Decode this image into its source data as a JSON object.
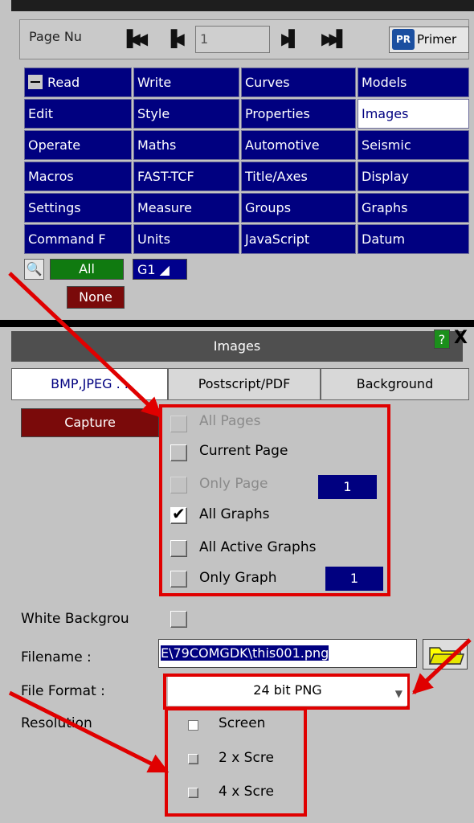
{
  "page_nav": {
    "label": "Page Nu",
    "page_value": "1",
    "primer_label": "Primer",
    "primer_logo": "PR"
  },
  "menu": {
    "rows": [
      [
        {
          "label": "Read",
          "minus": true
        },
        {
          "label": "Write"
        },
        {
          "label": "Curves"
        },
        {
          "label": "Models"
        }
      ],
      [
        {
          "label": "Edit"
        },
        {
          "label": "Style"
        },
        {
          "label": "Properties"
        },
        {
          "label": "Images",
          "active": true
        }
      ],
      [
        {
          "label": "Operate"
        },
        {
          "label": "Maths"
        },
        {
          "label": "Automotive"
        },
        {
          "label": "Seismic"
        }
      ],
      [
        {
          "label": "Macros"
        },
        {
          "label": "FAST-TCF"
        },
        {
          "label": "Title/Axes"
        },
        {
          "label": "Display"
        }
      ],
      [
        {
          "label": "Settings"
        },
        {
          "label": "Measure"
        },
        {
          "label": "Groups"
        },
        {
          "label": "Graphs"
        }
      ],
      [
        {
          "label": "Command F"
        },
        {
          "label": "Units"
        },
        {
          "label": "JavaScript"
        },
        {
          "label": "Datum"
        }
      ]
    ]
  },
  "graph_select": {
    "all_label": "All",
    "none_label": "None",
    "g1_label": "G1"
  },
  "panel": {
    "title": "Images",
    "help_label": "?",
    "close_label": "X",
    "tabs": [
      "BMP,JPEG . .",
      "Postscript/PDF",
      "Background"
    ],
    "capture_label": "Capture"
  },
  "capture_options": [
    {
      "label": "All Pages",
      "checked": false,
      "disabled": true
    },
    {
      "label": "Current Page",
      "checked": false,
      "disabled": false
    },
    {
      "label": "Only Page",
      "checked": false,
      "disabled": true,
      "value": "1"
    },
    {
      "label": "All Graphs",
      "checked": true,
      "disabled": false
    },
    {
      "label": "All Active Graphs",
      "checked": false,
      "disabled": false
    },
    {
      "label": "Only Graph",
      "checked": false,
      "disabled": false,
      "value": "1"
    }
  ],
  "white_background": {
    "label": "White Backgrou",
    "checked": false
  },
  "filename": {
    "label": "Filename :",
    "value": "E\\79COMGDK\\this001.png"
  },
  "file_format": {
    "label": "File Format :",
    "value": "24 bit PNG"
  },
  "resolution": {
    "label": "Resolution",
    "options": [
      {
        "label": "Screen",
        "checked": true
      },
      {
        "label": "2 x Scre",
        "checked": false
      },
      {
        "label": "4 x Scre",
        "checked": false
      }
    ]
  },
  "colors": {
    "menu_blue": "#000080",
    "highlight_red": "#e00000",
    "capture_red": "#7a0a0a",
    "all_green": "#107a10"
  }
}
